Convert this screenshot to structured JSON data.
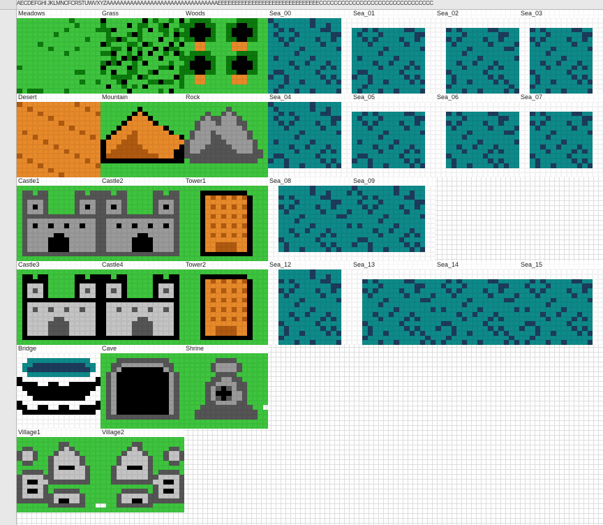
{
  "columns_header": "AECDEFGHI JKLMNCFCRSTUWVXYZAAAAAAAAAAAAAAAAAAAAAAAAAAAAAAAAAEEEEEEEEEEEEEEEEEEEEEEEEEEEEEECCCCCCCCCCCCCCCCCCCCCCCCCCCCCCC",
  "palette": {
    "green": "#3ec43e",
    "dark_green": "#0c7a0c",
    "black": "#000000",
    "orange": "#e88a2a",
    "dark_orange": "#b05a10",
    "grey": "#9a9a9a",
    "dark_grey": "#555555",
    "white": "#ffffff",
    "teal": "#0e8a8a",
    "navy": "#1d3b5c",
    "light_grey": "#c4c4c4"
  },
  "rows": [
    [
      {
        "label": "Meadows",
        "type": "meadows"
      },
      {
        "label": "Grass",
        "type": "grass"
      },
      {
        "label": "Woods",
        "type": "woods"
      },
      {
        "label": "Sea_00",
        "type": "sea",
        "variant": 0
      },
      {
        "label": "Sea_01",
        "type": "sea",
        "variant": 1
      },
      {
        "label": "Sea_02",
        "type": "sea",
        "variant": 2
      },
      {
        "label": "Sea_03",
        "type": "sea",
        "variant": 3
      }
    ],
    [
      {
        "label": "Desert",
        "type": "desert"
      },
      {
        "label": "Mountain",
        "type": "mountain"
      },
      {
        "label": "Rock",
        "type": "rock"
      },
      {
        "label": "Sea_04",
        "type": "sea",
        "variant": 4
      },
      {
        "label": "Sea_05",
        "type": "sea",
        "variant": 5
      },
      {
        "label": "Sea_06",
        "type": "sea",
        "variant": 6
      },
      {
        "label": "Sea_07",
        "type": "sea",
        "variant": 7
      }
    ],
    [
      {
        "label": "Castle1",
        "type": "castle",
        "variant": 1
      },
      {
        "label": "Castle2",
        "type": "castle",
        "variant": 2
      },
      {
        "label": "Tower1",
        "type": "tower",
        "variant": 1
      },
      {
        "label": "Sea_08",
        "type": "sea",
        "variant": 8
      },
      {
        "label": "Sea_09",
        "type": "sea",
        "variant": 9
      },
      {
        "label": "",
        "type": "empty"
      },
      {
        "label": "",
        "type": "empty"
      }
    ],
    [
      {
        "label": "Castle3",
        "type": "castle",
        "variant": 3
      },
      {
        "label": "Castle4",
        "type": "castle",
        "variant": 4
      },
      {
        "label": "Tower2",
        "type": "tower",
        "variant": 2
      },
      {
        "label": "Sea_12",
        "type": "sea",
        "variant": 12
      },
      {
        "label": "Sea_13",
        "type": "sea",
        "variant": 13
      },
      {
        "label": "Sea_14",
        "type": "sea",
        "variant": 14
      },
      {
        "label": "Sea_15",
        "type": "sea",
        "variant": 15
      }
    ],
    [
      {
        "label": "Bridge",
        "type": "bridge"
      },
      {
        "label": "Cave",
        "type": "cave"
      },
      {
        "label": "Shrine",
        "type": "shrine"
      },
      {
        "label": "",
        "type": "empty"
      },
      {
        "label": "",
        "type": "empty"
      },
      {
        "label": "",
        "type": "empty"
      },
      {
        "label": "",
        "type": "empty"
      }
    ],
    [
      {
        "label": "Village1",
        "type": "village",
        "variant": 1
      },
      {
        "label": "Village2",
        "type": "village",
        "variant": 2
      },
      {
        "label": "",
        "type": "empty"
      },
      {
        "label": "",
        "type": "empty"
      },
      {
        "label": "",
        "type": "empty"
      },
      {
        "label": "",
        "type": "empty"
      },
      {
        "label": "",
        "type": "empty"
      }
    ]
  ]
}
